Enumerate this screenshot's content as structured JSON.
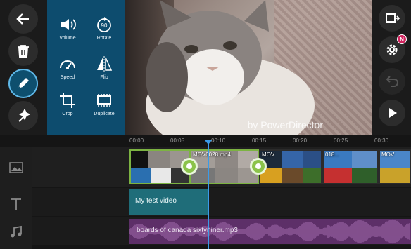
{
  "left_toolbar": {
    "items": [
      {
        "name": "back-arrow-icon"
      },
      {
        "name": "trash-icon"
      },
      {
        "name": "pencil-icon"
      },
      {
        "name": "magic-wand-icon"
      }
    ]
  },
  "edit_menu": {
    "items": [
      {
        "label": "Volume",
        "icon": "volume-icon"
      },
      {
        "label": "Rotate",
        "icon": "rotate-icon",
        "badge": "90"
      },
      {
        "label": "Speed",
        "icon": "speed-gauge-icon"
      },
      {
        "label": "Flip",
        "icon": "flip-icon"
      },
      {
        "label": "Crop",
        "icon": "crop-icon"
      },
      {
        "label": "Duplicate",
        "icon": "duplicate-icon"
      }
    ]
  },
  "preview": {
    "watermark": "by PowerDirector"
  },
  "right_toolbar": {
    "items": [
      {
        "name": "export-film-icon"
      },
      {
        "name": "settings-gear-icon",
        "badge": "N"
      },
      {
        "name": "undo-icon",
        "disabled": true
      },
      {
        "name": "play-icon"
      }
    ]
  },
  "timeline": {
    "ticks": [
      "00:00",
      "00:05",
      "00:10",
      "00:15",
      "00:20",
      "00:25",
      "00:30"
    ],
    "video_clips": [
      {
        "label": ""
      },
      {
        "label": "MOV0028.mp4"
      },
      {
        "label": "MOV"
      },
      {
        "label": "018..."
      },
      {
        "label": "MOV"
      }
    ],
    "text_clip": "My test video",
    "audio_clip": "boards of canada sixtyniner.mp3"
  },
  "colors": {
    "accent_blue": "#0d4c6e",
    "playhead": "#3b9be8",
    "clip_border": "#7cb342",
    "text_track": "#1f6d79",
    "audio_track": "#5d2f68",
    "badge": "#d0245e"
  }
}
